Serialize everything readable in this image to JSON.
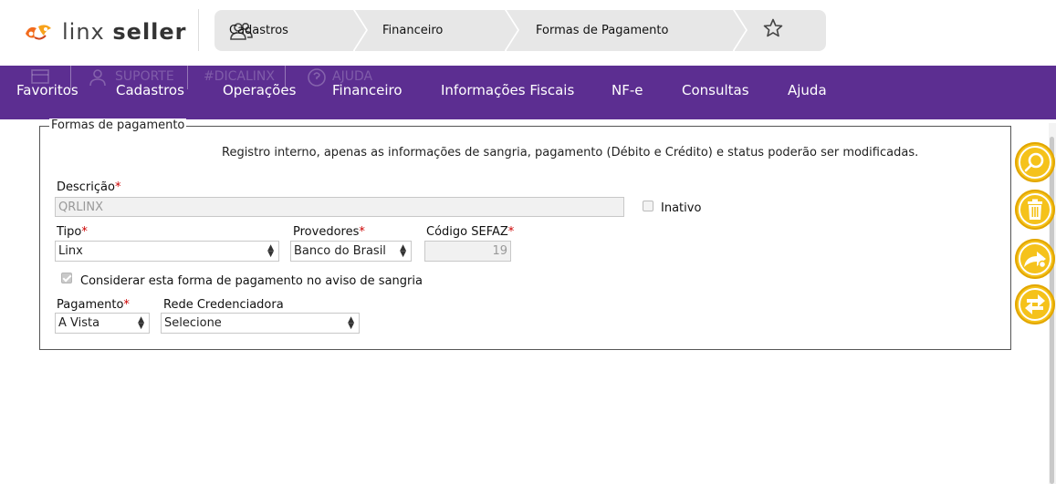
{
  "header": {
    "logo_light": "linx",
    "logo_bold": "seller",
    "breadcrumbs": [
      {
        "label": "Cadastros",
        "icon": "users-icon"
      },
      {
        "label": "Financeiro"
      },
      {
        "label": "Formas de Pagamento"
      }
    ],
    "favorite_icon": "star-icon"
  },
  "ghost_menu": {
    "suporte": "SUPORTE",
    "dicalinx": "#DICALINX",
    "ajuda": "AJUDA"
  },
  "menu": {
    "items": [
      "Favoritos",
      "Cadastros",
      "Operações",
      "Financeiro",
      "Informações Fiscais",
      "NF-e",
      "Consultas",
      "Ajuda"
    ]
  },
  "form": {
    "legend": "Formas de pagamento",
    "notice": "Registro interno, apenas as informações de sangria, pagamento (Débito e Crédito) e status poderão ser modificadas.",
    "descricao_label": "Descrição",
    "descricao_value": "QRLINX",
    "inativo_label": "Inativo",
    "inativo_checked": false,
    "tipo_label": "Tipo",
    "tipo_value": "Linx",
    "provedores_label": "Provedores",
    "provedores_value": "Banco do Brasil",
    "codigo_label": "Código SEFAZ",
    "codigo_value": "19",
    "sangria_label": "Considerar esta forma de pagamento no aviso de sangria",
    "sangria_checked": true,
    "pagamento_label": "Pagamento",
    "pagamento_value": "A Vista",
    "rede_label": "Rede Credenciadora",
    "rede_value": "Selecione",
    "required_mark": "*"
  },
  "actions": [
    {
      "name": "search",
      "icon": "magnifier-icon"
    },
    {
      "name": "delete",
      "icon": "trash-icon"
    },
    {
      "name": "forward",
      "icon": "share-arrow-icon"
    },
    {
      "name": "swap",
      "icon": "swap-arrows-icon"
    }
  ],
  "colors": {
    "menu_bg": "#5c2e91",
    "action_bg": "#f5c21b",
    "breadcrumb_bg": "#e7e7e7",
    "required": "#cc0000"
  }
}
